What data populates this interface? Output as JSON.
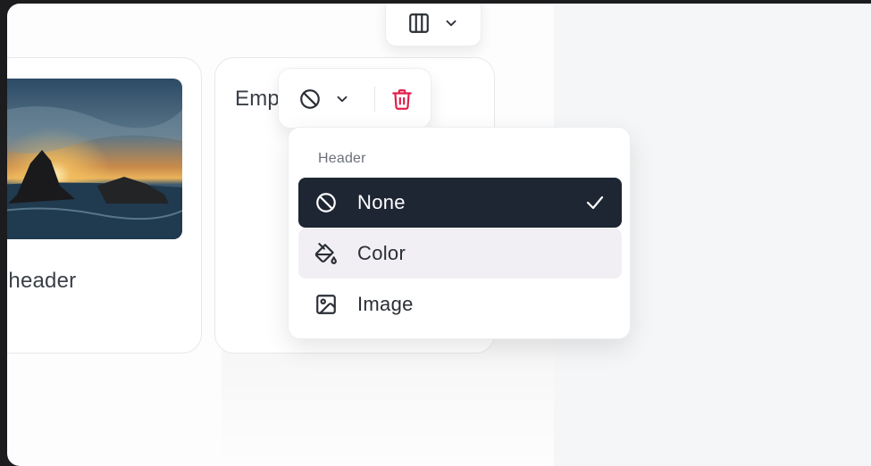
{
  "cards": {
    "left": {
      "caption": "e header"
    },
    "right": {
      "title": "Emp"
    }
  },
  "toolbar": {
    "columns_icon": "columns-icon",
    "header_icon": "ban-icon",
    "delete_icon": "trash-icon",
    "delete_color": "#e11d48"
  },
  "menu": {
    "label": "Header",
    "items": [
      {
        "label": "None",
        "icon": "ban-icon",
        "selected": true
      },
      {
        "label": "Color",
        "icon": "paint-bucket-icon",
        "selected": false
      },
      {
        "label": "Image",
        "icon": "image-icon",
        "selected": false
      }
    ]
  },
  "colors": {
    "selected_bg": "#1e2633",
    "hover_bg": "#f1eff3",
    "panel_bg": "#f4f6f7"
  }
}
